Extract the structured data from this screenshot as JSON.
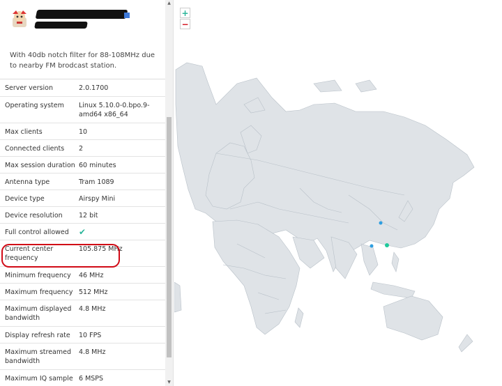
{
  "receiver": {
    "description": "With 40db notch filter for 88-108MHz due to nearby FM brodcast station."
  },
  "info_rows": [
    {
      "key": "Server version",
      "value": "2.0.1700"
    },
    {
      "key": "Operating system",
      "value": "Linux 5.10.0-0.bpo.9-amd64 x86_64"
    },
    {
      "key": "Max clients",
      "value": "10"
    },
    {
      "key": "Connected clients",
      "value": "2"
    },
    {
      "key": "Max session duration",
      "value": "60 minutes"
    },
    {
      "key": "Antenna type",
      "value": "Tram 1089"
    },
    {
      "key": "Device type",
      "value": "Airspy Mini"
    },
    {
      "key": "Device resolution",
      "value": "12 bit"
    },
    {
      "key": "Full control allowed",
      "value": "check"
    },
    {
      "key": "Current center frequency",
      "value": "105.875 MHz"
    },
    {
      "key": "Minimum frequency",
      "value": "46 MHz"
    },
    {
      "key": "Maximum frequency",
      "value": "512 MHz"
    },
    {
      "key": "Maximum displayed bandwidth",
      "value": "4.8 MHz"
    },
    {
      "key": "Display refresh rate",
      "value": "10 FPS"
    },
    {
      "key": "Maximum streamed bandwidth",
      "value": "4.8 MHz"
    },
    {
      "key": "Maximum IQ sample",
      "value": "6 MSPS"
    }
  ],
  "map": {
    "zoom_in": "+",
    "zoom_out": "−",
    "colors": {
      "land": "#dfe3e7",
      "border": "#b8c0c8",
      "marker_blue": "#2e9ee0",
      "marker_green": "#1fc99b"
    }
  },
  "icons": {
    "check": "✔",
    "scroll_up": "▲",
    "scroll_down": "▼"
  }
}
